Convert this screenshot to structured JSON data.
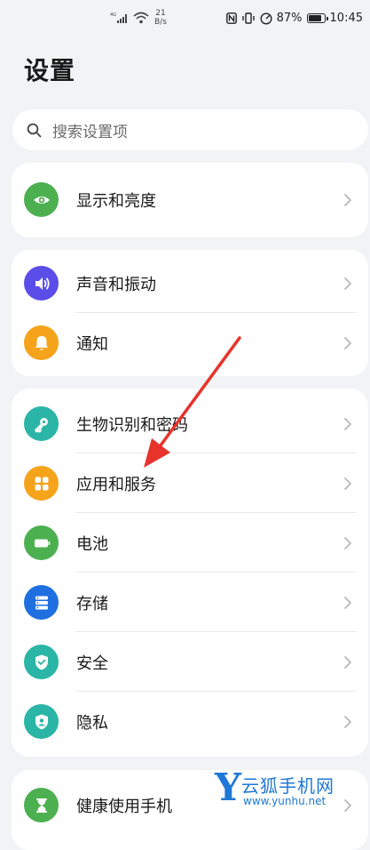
{
  "status_bar": {
    "net_speed_value": "21",
    "net_speed_unit": "B/s",
    "battery_percent": "87%",
    "time": "10:45"
  },
  "page": {
    "title": "设置"
  },
  "search": {
    "placeholder": "搜索设置项"
  },
  "cards": [
    {
      "items": [
        {
          "label": "显示和亮度",
          "icon": "eye-icon",
          "color": "#4cb050"
        }
      ]
    },
    {
      "items": [
        {
          "label": "声音和振动",
          "icon": "volume-icon",
          "color": "#5b4ee8"
        },
        {
          "label": "通知",
          "icon": "bell-icon",
          "color": "#f5a31a"
        }
      ]
    },
    {
      "items": [
        {
          "label": "生物识别和密码",
          "icon": "key-icon",
          "color": "#2ab5a6"
        },
        {
          "label": "应用和服务",
          "icon": "apps-grid-icon",
          "color": "#f5a31a"
        },
        {
          "label": "电池",
          "icon": "battery-icon",
          "color": "#4cb050"
        },
        {
          "label": "存储",
          "icon": "storage-icon",
          "color": "#1f6fe0"
        },
        {
          "label": "安全",
          "icon": "shield-icon",
          "color": "#2ab5a6"
        },
        {
          "label": "隐私",
          "icon": "privacy-icon",
          "color": "#2ab5a6"
        }
      ]
    },
    {
      "items": [
        {
          "label": "健康使用手机",
          "icon": "hourglass-icon",
          "color": "#4cb050"
        }
      ]
    }
  ],
  "watermark": {
    "logo_letter": "Y",
    "brand": "云狐手机网",
    "url": "www.yunhu.net"
  }
}
